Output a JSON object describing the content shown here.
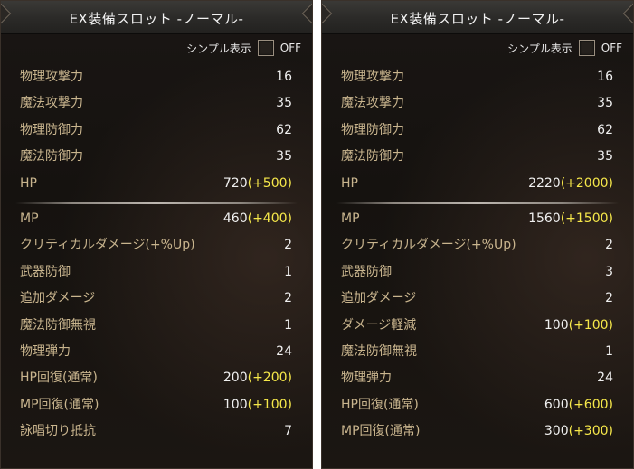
{
  "left": {
    "title": "EX装備スロット -ノーマル-",
    "simple_label": "シンプル表示",
    "simple_state": "OFF",
    "stats": [
      {
        "label": "物理攻撃力",
        "value": "16",
        "bonus": ""
      },
      {
        "label": "魔法攻撃力",
        "value": "35",
        "bonus": ""
      },
      {
        "label": "物理防御力",
        "value": "62",
        "bonus": ""
      },
      {
        "label": "魔法防御力",
        "value": "35",
        "bonus": ""
      },
      {
        "label": "HP",
        "value": "720",
        "bonus": "(+500)"
      },
      {
        "label": "MP",
        "value": "460",
        "bonus": "(+400)"
      },
      {
        "label": "クリティカルダメージ(+%Up)",
        "value": "2",
        "bonus": ""
      },
      {
        "label": "武器防御",
        "value": "1",
        "bonus": ""
      },
      {
        "label": "追加ダメージ",
        "value": "2",
        "bonus": ""
      },
      {
        "label": "魔法防御無視",
        "value": "1",
        "bonus": ""
      },
      {
        "label": "物理弾力",
        "value": "24",
        "bonus": ""
      },
      {
        "label": "HP回復(通常)",
        "value": "200",
        "bonus": "(+200)"
      },
      {
        "label": "MP回復(通常)",
        "value": "100",
        "bonus": "(+100)"
      },
      {
        "label": "詠唱切り抵抗",
        "value": "7",
        "bonus": ""
      }
    ]
  },
  "right": {
    "title": "EX装備スロット -ノーマル-",
    "simple_label": "シンプル表示",
    "simple_state": "OFF",
    "stats": [
      {
        "label": "物理攻撃力",
        "value": "16",
        "bonus": ""
      },
      {
        "label": "魔法攻撃力",
        "value": "35",
        "bonus": ""
      },
      {
        "label": "物理防御力",
        "value": "62",
        "bonus": ""
      },
      {
        "label": "魔法防御力",
        "value": "35",
        "bonus": ""
      },
      {
        "label": "HP",
        "value": "2220",
        "bonus": "(+2000)"
      },
      {
        "label": "MP",
        "value": "1560",
        "bonus": "(+1500)"
      },
      {
        "label": "クリティカルダメージ(+%Up)",
        "value": "2",
        "bonus": ""
      },
      {
        "label": "武器防御",
        "value": "3",
        "bonus": ""
      },
      {
        "label": "追加ダメージ",
        "value": "2",
        "bonus": ""
      },
      {
        "label": "ダメージ軽減",
        "value": "100",
        "bonus": "(+100)"
      },
      {
        "label": "魔法防御無視",
        "value": "1",
        "bonus": ""
      },
      {
        "label": "物理弾力",
        "value": "24",
        "bonus": ""
      },
      {
        "label": "HP回復(通常)",
        "value": "600",
        "bonus": "(+600)"
      },
      {
        "label": "MP回復(通常)",
        "value": "300",
        "bonus": "(+300)"
      }
    ]
  },
  "colors": {
    "label": "#c9b58e",
    "value": "#f0f0f0",
    "bonus": "#f6e84a"
  }
}
